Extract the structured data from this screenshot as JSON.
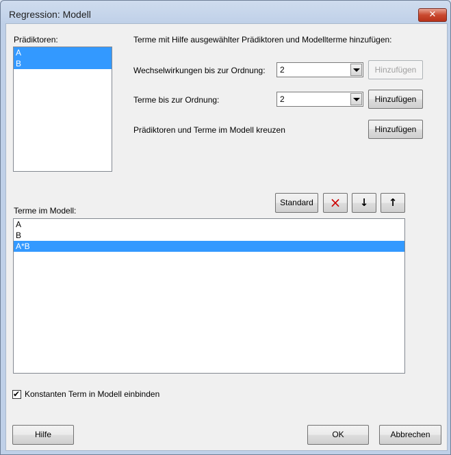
{
  "window": {
    "title": "Regression: Modell",
    "close_symbol": "✕"
  },
  "praediktoren": {
    "label": "Prädiktoren:",
    "items": [
      {
        "label": "A",
        "selected": true
      },
      {
        "label": "B",
        "selected": true
      }
    ]
  },
  "instruction": "Terme mit Hilfe ausgewählter Prädiktoren und Modellterme hinzufügen:",
  "wechselwirkungen": {
    "label": "Wechselwirkungen bis zur Ordnung:",
    "value": "2",
    "button": "Hinzufügen",
    "button_enabled": false
  },
  "terme_ordnung": {
    "label": "Terme bis zur Ordnung:",
    "value": "2",
    "button": "Hinzufügen"
  },
  "kreuzen": {
    "label": "Prädiktoren und Terme im Modell kreuzen",
    "button": "Hinzufügen"
  },
  "terme_modell": {
    "label": "Terme im Modell:",
    "standard_button": "Standard",
    "delete_icon": "×",
    "down_icon": "↓",
    "up_icon": "↑",
    "items": [
      {
        "label": "A",
        "selected": false
      },
      {
        "label": "B",
        "selected": false
      },
      {
        "label": "A*B",
        "selected": true
      }
    ]
  },
  "constant_term": {
    "label": "Konstanten Term in Modell einbinden",
    "checked": true,
    "check_mark": "✔"
  },
  "buttons": {
    "help": "Hilfe",
    "ok": "OK",
    "cancel": "Abbrechen"
  },
  "colors": {
    "selection": "#3399ff",
    "delete_icon": "#cc0000"
  }
}
